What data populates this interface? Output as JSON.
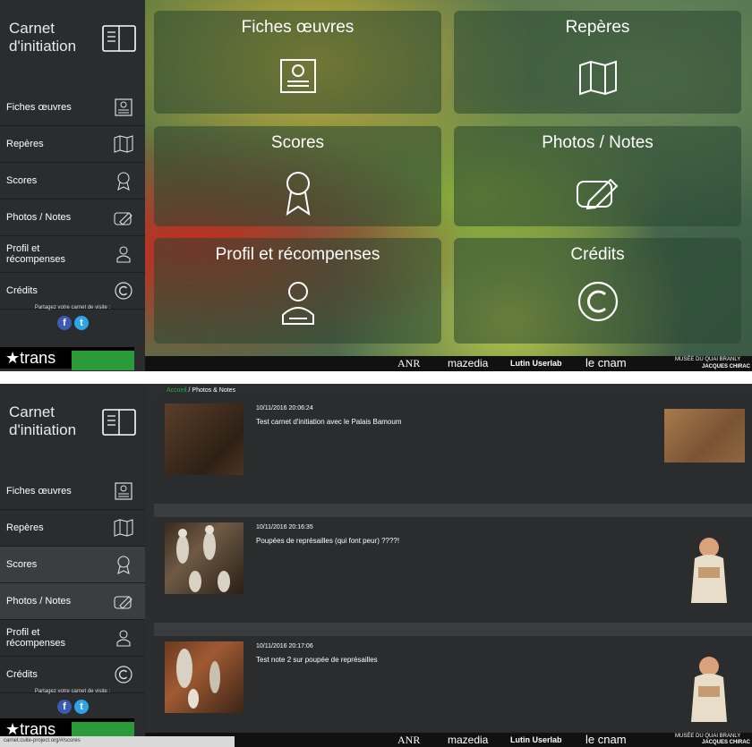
{
  "brand": {
    "title": "Carnet d'initiation"
  },
  "menu": [
    {
      "label": "Fiches œuvres",
      "icon": "id-card-icon"
    },
    {
      "label": "Repères",
      "icon": "map-icon"
    },
    {
      "label": "Scores",
      "icon": "award-icon"
    },
    {
      "label": "Photos / Notes",
      "icon": "camera-pencil-icon"
    },
    {
      "label": "Profil et récompenses",
      "icon": "user-badge-icon"
    },
    {
      "label": "Crédits",
      "icon": "copyright-icon"
    }
  ],
  "share": {
    "text": "Partagez votre carnet de visite :",
    "facebook": "f",
    "twitter": "t"
  },
  "trans_logo": "★trans",
  "tiles": [
    {
      "label": "Fiches œuvres",
      "icon": "id-card-icon"
    },
    {
      "label": "Repères",
      "icon": "map-icon"
    },
    {
      "label": "Scores",
      "icon": "award-icon"
    },
    {
      "label": "Photos / Notes",
      "icon": "camera-pencil-icon"
    },
    {
      "label": "Profil et récompenses",
      "icon": "user-badge-icon"
    },
    {
      "label": "Crédits",
      "icon": "copyright-icon"
    }
  ],
  "footer": {
    "anr": "ANR",
    "mazedia": "mazedia",
    "lutin": "Lutin Userlab",
    "cnam": "le cnam",
    "musee1": "MUSÉE DU QUAI BRANLY",
    "musee2": "JACQUES CHIRAC"
  },
  "breadcrumb": {
    "home": "Accueil",
    "current": " / Photos & Notes"
  },
  "notes": [
    {
      "date": "10/11/2016 20:06:24",
      "text": "Test carnet d'initiation avec le Palais Bamoum"
    },
    {
      "date": "10/11/2016 20:16:35",
      "text": "Poupées de représailles (qui font peur) ????!"
    },
    {
      "date": "10/11/2016 20:17:06",
      "text": "Test note 2 sur poupée de représailles"
    }
  ],
  "status_url": "carnet.cuite-project.org/#/scores",
  "colors": {
    "accent_green": "#2ea84a",
    "sidebar": "#2a2c2e"
  }
}
